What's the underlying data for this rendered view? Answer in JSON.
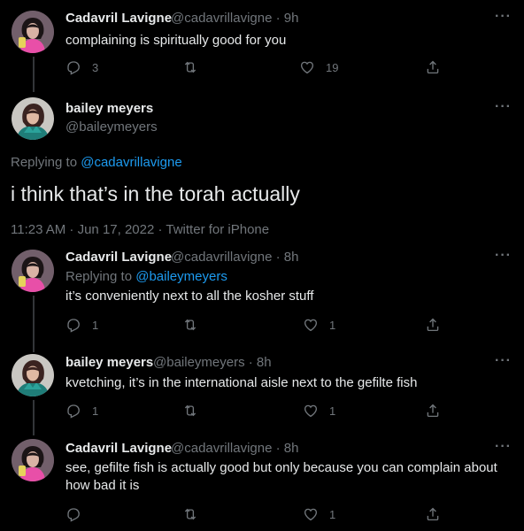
{
  "colors": {
    "background": "#000000",
    "text": "#e7e9ea",
    "secondary": "#71767b",
    "link": "#1d9bf0",
    "divider": "#2f3336"
  },
  "tweets": [
    {
      "name": "Cadavril Lavigne",
      "handle_time": "@cadavrillavigne · 9h",
      "text": "complaining is spiritually good for you",
      "replies": "3",
      "retweets": "",
      "likes": "19"
    }
  ],
  "focus": {
    "name": "bailey meyers",
    "handle": "@baileymeyers",
    "replying_prefix": "Replying to",
    "replying_handle": "@cadavrillavigne",
    "text": "i think that’s in the torah actually",
    "timestamp": "11:23 AM · Jun 17, 2022 · Twitter for iPhone"
  },
  "replies": [
    {
      "name": "Cadavril Lavigne",
      "handle_time": "@cadavrillavigne · 8h",
      "replying_prefix": "Replying to",
      "replying_handle": "@baileymeyers",
      "text": "it’s conveniently next to all the kosher stuff",
      "replies": "1",
      "likes": "1"
    },
    {
      "name": "bailey meyers",
      "handle_time": "@baileymeyers · 8h",
      "text": "kvetching, it’s in the international aisle next to the gefilte fish",
      "replies": "1",
      "likes": "1"
    },
    {
      "name": "Cadavril Lavigne",
      "handle_time": "@cadavrillavigne · 8h",
      "text_line1": "see, gefilte fish is actually good but only because you can complain about",
      "text_line2": "how bad it is",
      "replies": "",
      "likes": "1"
    }
  ],
  "more_label": "···"
}
